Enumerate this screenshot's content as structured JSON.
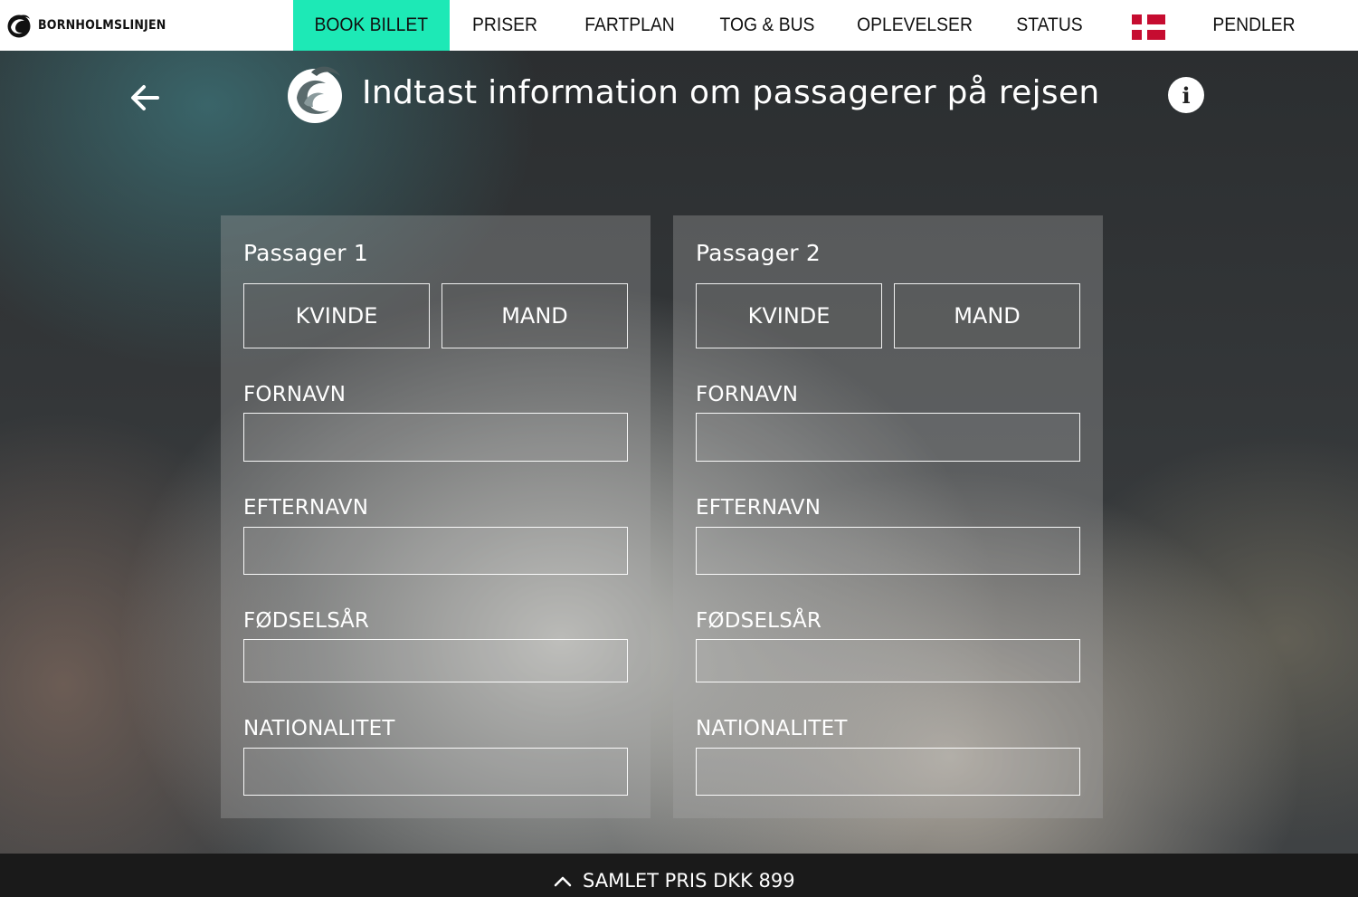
{
  "brand": {
    "name": "BORNHOLMSLINJEN"
  },
  "nav": {
    "items": [
      "BOOK BILLET",
      "PRISER",
      "FARTPLAN",
      "TOG & BUS",
      "OPLEVELSER",
      "STATUS",
      "PENDLER"
    ],
    "active": "BOOK BILLET",
    "accent_color": "#1de9b6",
    "language_flag": "denmark-flag-icon"
  },
  "header": {
    "title": "Indtast information om passagerer på rejsen",
    "back_icon": "arrow-left-icon",
    "info_icon": "info-icon",
    "info_glyph": "i"
  },
  "passengers": [
    {
      "title": "Passager 1",
      "gender_options": [
        "KVINDE",
        "MAND"
      ],
      "fields": {
        "first_name": {
          "label": "FORNAVN",
          "value": ""
        },
        "last_name": {
          "label": "EFTERNAVN",
          "value": ""
        },
        "birth_year": {
          "label": "FØDSELSÅR",
          "value": ""
        },
        "nationality": {
          "label": "NATIONALITET",
          "value": ""
        }
      }
    },
    {
      "title": "Passager 2",
      "gender_options": [
        "KVINDE",
        "MAND"
      ],
      "fields": {
        "first_name": {
          "label": "FORNAVN",
          "value": ""
        },
        "last_name": {
          "label": "EFTERNAVN",
          "value": ""
        },
        "birth_year": {
          "label": "FØDSELSÅR",
          "value": ""
        },
        "nationality": {
          "label": "NATIONALITET",
          "value": ""
        }
      }
    }
  ],
  "footer": {
    "total_label": "SAMLET PRIS DKK 899",
    "expand_icon": "chevron-up-icon"
  }
}
